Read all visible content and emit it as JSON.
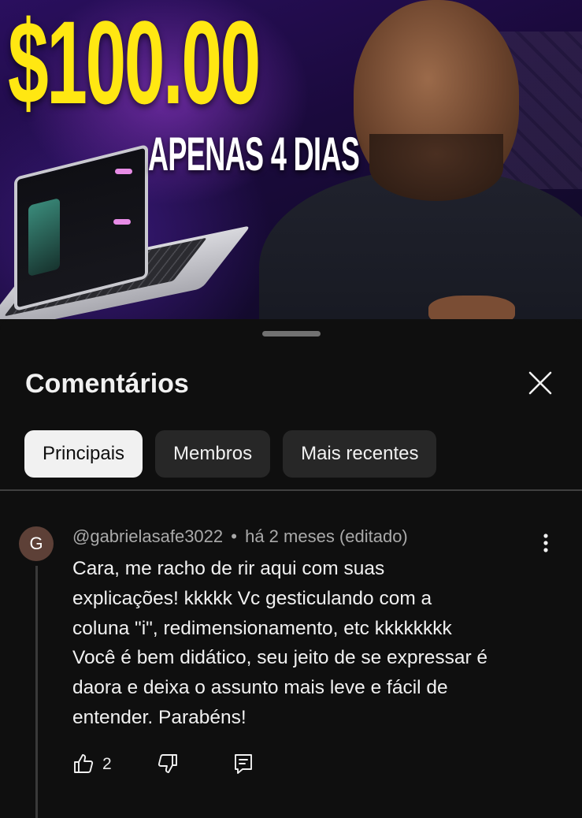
{
  "video": {
    "headline": "$100.00",
    "subheadline": "APENAS 4 DIAS",
    "accent_color": "#ffe712"
  },
  "sheet": {
    "title": "Comentários",
    "close_icon": "close-icon",
    "chips": [
      {
        "label": "Principais",
        "active": true
      },
      {
        "label": "Membros",
        "active": false
      },
      {
        "label": "Mais recentes",
        "active": false
      }
    ]
  },
  "comment": {
    "avatar_letter": "G",
    "avatar_color": "#5d4037",
    "author": "@gabrielasafe3022",
    "separator": "•",
    "time": "há 2 meses (editado)",
    "lines": [
      "Cara, me racho de rir aqui com suas",
      "explicações! kkkkk Vc gesticulando com a",
      "coluna \"i\", redimensionamento, etc kkkkkkkk",
      "Você é bem didático, seu jeito de se expressar é",
      "daora e deixa o assunto mais leve e fácil de",
      "entender. Parabéns!"
    ],
    "like_count": "2",
    "icons": {
      "like": "thumbs-up-icon",
      "dislike": "thumbs-down-icon",
      "reply": "reply-icon",
      "menu": "more-vertical-icon"
    }
  }
}
